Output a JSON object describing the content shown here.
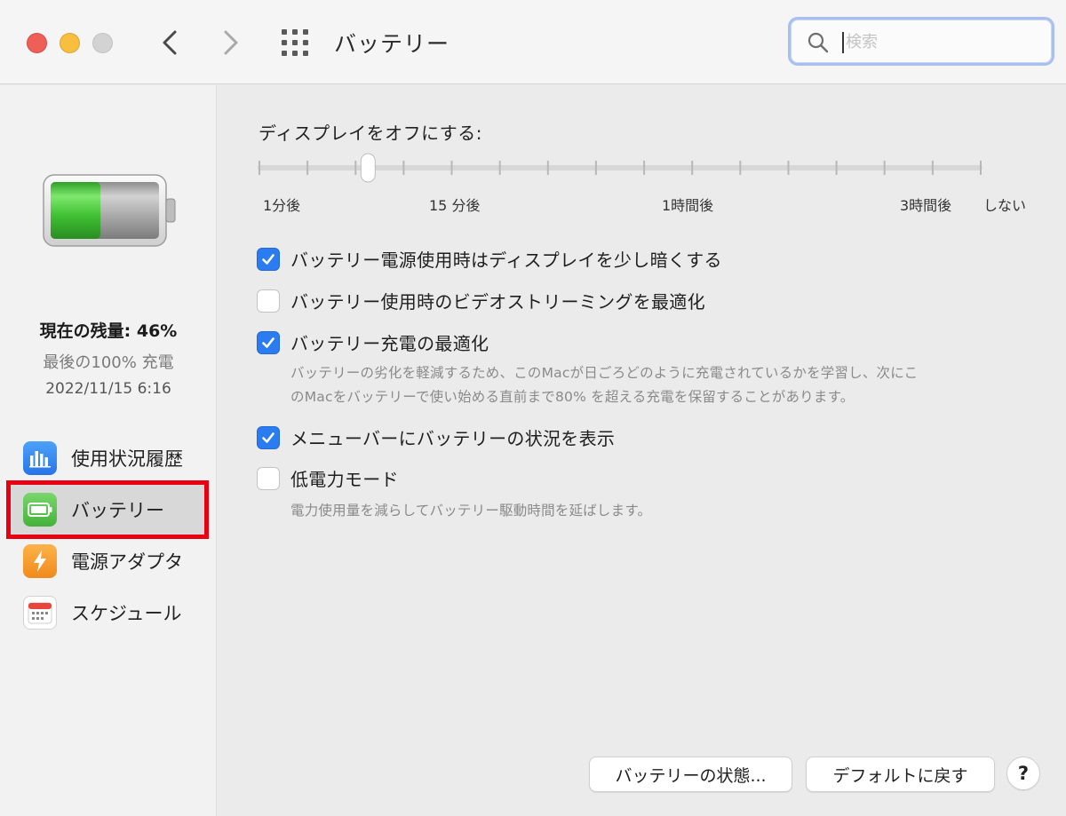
{
  "window": {
    "title": "バッテリー",
    "search_placeholder": "検索"
  },
  "sidebar": {
    "battery_status": {
      "level_label": "現在の残量: 46%",
      "level_percent": 46,
      "last_charge": "最後の100% 充電",
      "last_charge_date": "2022/11/15 6:16"
    },
    "items": [
      {
        "label": "使用状況履歴",
        "icon": "bar-chart-icon",
        "selected": false
      },
      {
        "label": "バッテリー",
        "icon": "battery-icon",
        "selected": true
      },
      {
        "label": "電源アダプタ",
        "icon": "lightning-icon",
        "selected": false
      },
      {
        "label": "スケジュール",
        "icon": "calendar-icon",
        "selected": false
      }
    ],
    "highlight_color": "#e60012"
  },
  "main": {
    "display_off_label": "ディスプレイをオフにする:",
    "slider": {
      "tick_labels": [
        "1分後",
        "15 分後",
        "1時間後",
        "3時間後",
        "しない"
      ],
      "tick_count": 16,
      "value_tick_index": 2
    },
    "options": [
      {
        "label": "バッテリー電源使用時はディスプレイを少し暗くする",
        "checked": true
      },
      {
        "label": "バッテリー使用時のビデオストリーミングを最適化",
        "checked": false
      },
      {
        "label": "バッテリー充電の最適化",
        "checked": true,
        "description": [
          "バッテリーの劣化を軽減するため、このMacが日ごろどのように充電されているかを学習し、次にこ",
          "のMacをバッテリーで使い始める直前まで80% を超える充電を保留することがあります。"
        ]
      },
      {
        "label": "メニューバーにバッテリーの状況を表示",
        "checked": true
      },
      {
        "label": "低電力モード",
        "checked": false,
        "description": [
          "電力使用量を減らしてバッテリー駆動時間を延ばします。"
        ]
      }
    ],
    "buttons": {
      "battery_health": "バッテリーの状態...",
      "restore_defaults": "デフォルトに戻す",
      "help": "?"
    }
  },
  "colors": {
    "accent": "#2b7cf0",
    "battery_fill": "#3fbf32"
  }
}
